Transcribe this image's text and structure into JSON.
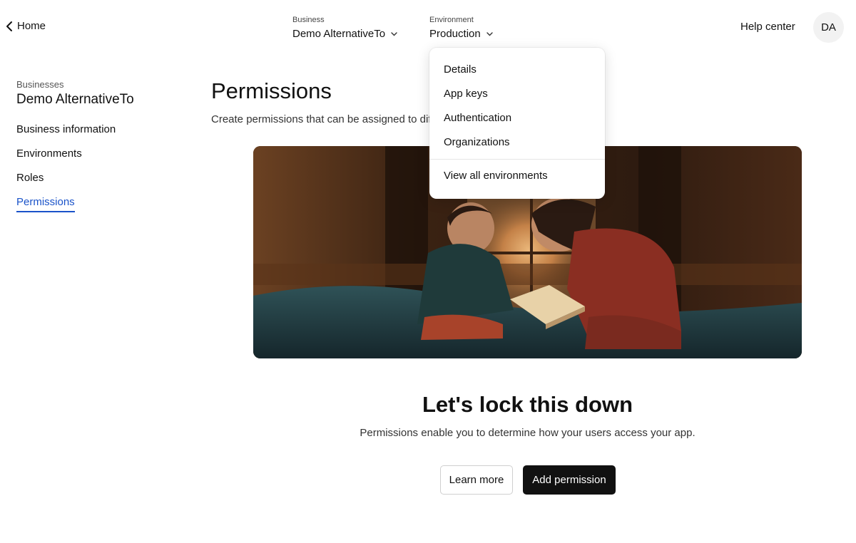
{
  "topbar": {
    "home_label": "Home",
    "business_selector": {
      "label": "Business",
      "value": "Demo AlternativeTo"
    },
    "environment_selector": {
      "label": "Environment",
      "value": "Production"
    },
    "help_label": "Help center",
    "avatar_initials": "DA"
  },
  "sidebar": {
    "section_label": "Businesses",
    "business_name": "Demo AlternativeTo",
    "items": [
      {
        "label": "Business information"
      },
      {
        "label": "Environments"
      },
      {
        "label": "Roles"
      },
      {
        "label": "Permissions"
      }
    ],
    "active_index": 3,
    "active_color": "#1a53c9"
  },
  "main": {
    "title": "Permissions",
    "description": "Create permissions that can be assigned to diffe",
    "empty_state": {
      "title": "Let's lock this down",
      "description": "Permissions enable you to determine how your users access your app.",
      "learn_more_label": "Learn more",
      "add_permission_label": "Add permission"
    }
  },
  "environment_menu": {
    "items": [
      {
        "label": "Details"
      },
      {
        "label": "App keys"
      },
      {
        "label": "Authentication"
      },
      {
        "label": "Organizations"
      }
    ],
    "footer_label": "View all environments"
  }
}
